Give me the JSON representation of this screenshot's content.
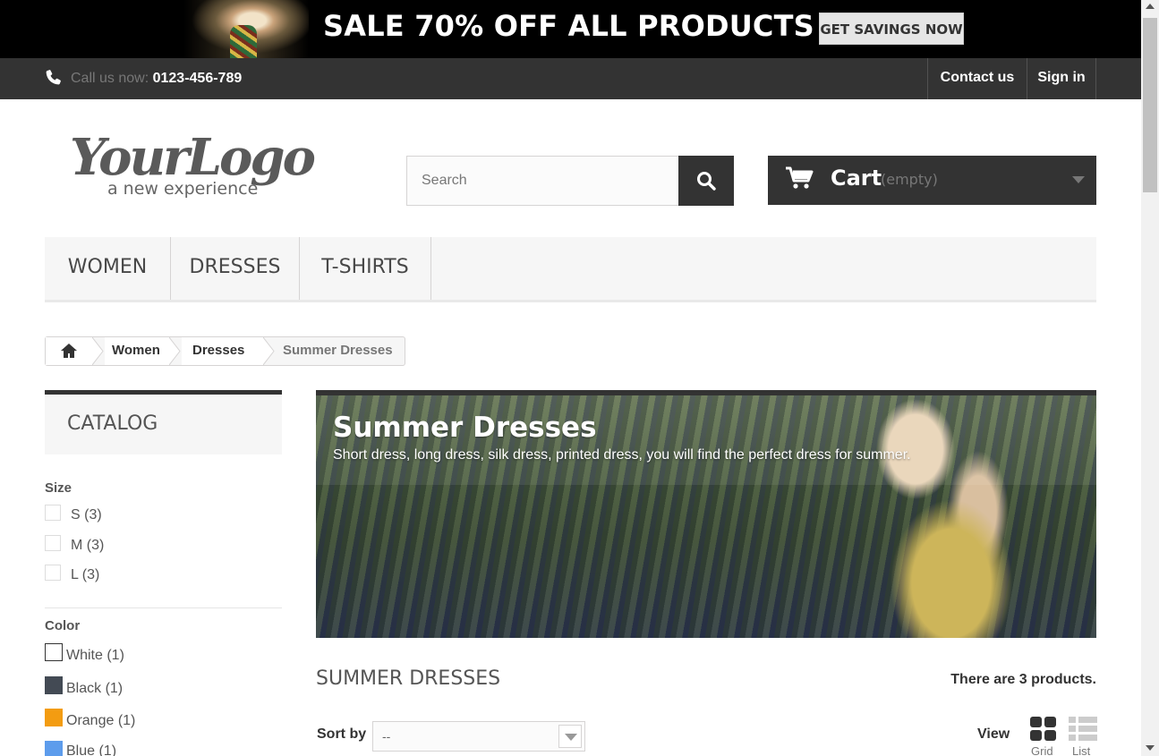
{
  "promo": {
    "headline": "SALE 70% OFF ALL PRODUCTS",
    "button_label": "GET SAVINGS NOW"
  },
  "topbar": {
    "call_prefix": "Call us now:",
    "phone": "0123-456-789",
    "contact_label": "Contact us",
    "signin_label": "Sign in"
  },
  "header": {
    "logo_main": "YourLogo",
    "logo_tagline": "a new experience",
    "search_placeholder": "Search",
    "cart_label": "Cart",
    "cart_status": "(empty)"
  },
  "menu": {
    "items": [
      {
        "label": "WOMEN"
      },
      {
        "label": "DRESSES"
      },
      {
        "label": "T-SHIRTS"
      }
    ]
  },
  "breadcrumb": {
    "items": [
      "Women",
      "Dresses",
      "Summer Dresses"
    ]
  },
  "sidebar": {
    "catalog_title": "CATALOG",
    "size_title": "Size",
    "sizes": [
      {
        "label": "S (3)"
      },
      {
        "label": "M (3)"
      },
      {
        "label": "L (3)"
      }
    ],
    "color_title": "Color",
    "colors": [
      {
        "label": "White (1)",
        "hex": "#ffffff"
      },
      {
        "label": "Black (1)",
        "hex": "#434a54"
      },
      {
        "label": "Orange (1)",
        "hex": "#f39c11"
      },
      {
        "label": "Blue (1)",
        "hex": "#5d9cec"
      }
    ]
  },
  "category": {
    "banner_title": "Summer Dresses",
    "banner_description": "Short dress, long dress, silk dress, printed dress, you will find the perfect dress for summer.",
    "heading": "SUMMER DRESSES",
    "product_count": "There are 3 products.",
    "sort_label": "Sort by",
    "sort_value": "--",
    "view_label": "View",
    "view_grid": "Grid",
    "view_list": "List"
  }
}
